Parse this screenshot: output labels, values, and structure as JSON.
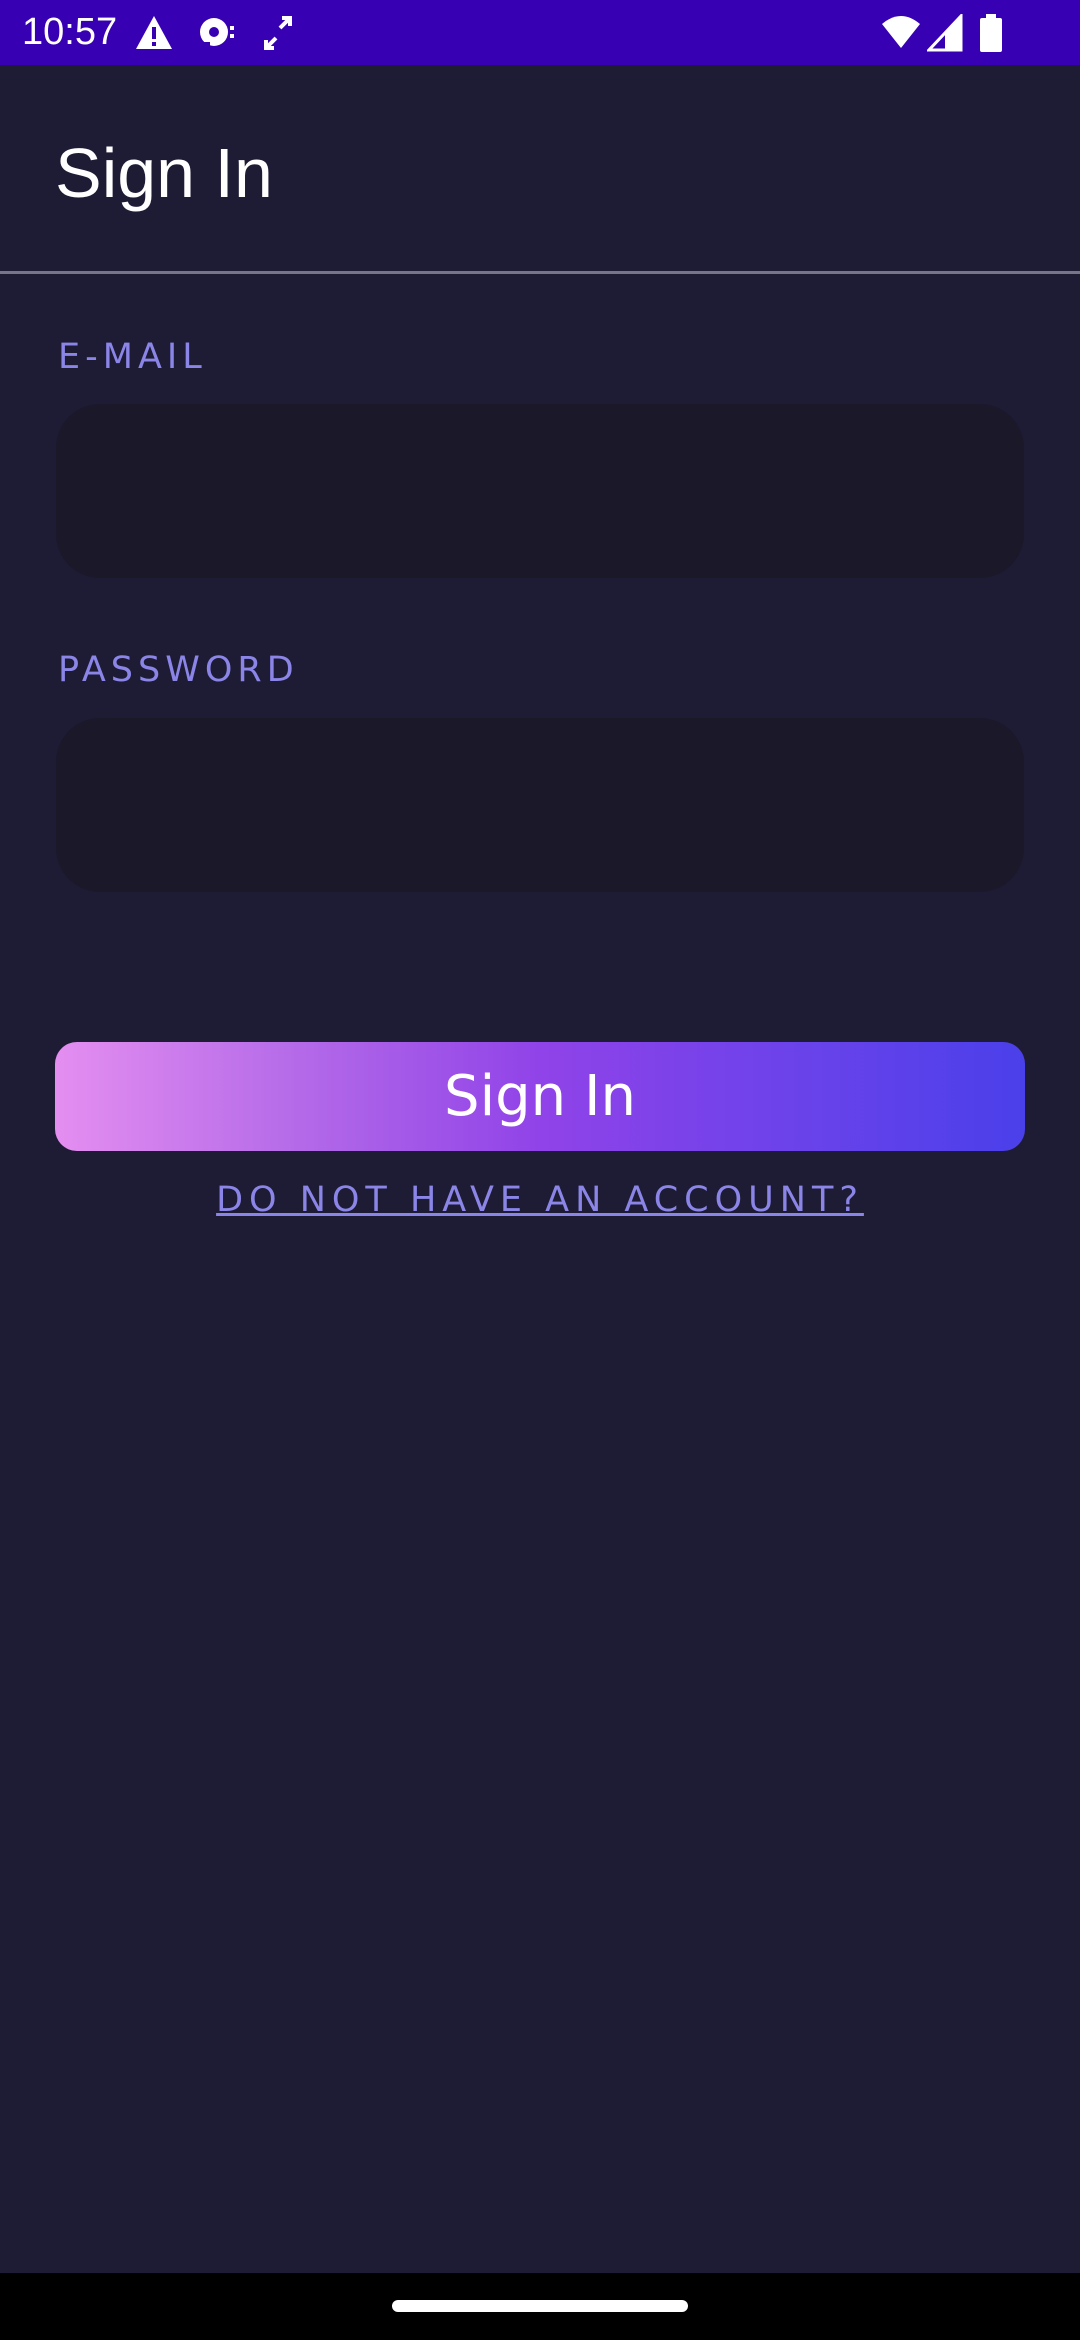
{
  "status_bar": {
    "time": "10:57",
    "background_color": "#3700b3",
    "left_icons": [
      "warning-icon",
      "sync-icon",
      "arrows-icon"
    ],
    "right_icons": [
      "wifi-icon",
      "signal-icon",
      "battery-icon"
    ]
  },
  "app_bar": {
    "title": "Sign In"
  },
  "form": {
    "email_label": "E-MAIL",
    "email_value": "",
    "password_label": "PASSWORD",
    "password_value": "",
    "submit_label": "Sign In",
    "account_link": "DO NOT HAVE AN ACCOUNT?"
  },
  "colors": {
    "background": "#1e1b35",
    "input_background": "#1a1829",
    "label_accent": "#8a85e6",
    "button_gradient_start": "#e48ef0",
    "button_gradient_end": "#4a40ea"
  }
}
